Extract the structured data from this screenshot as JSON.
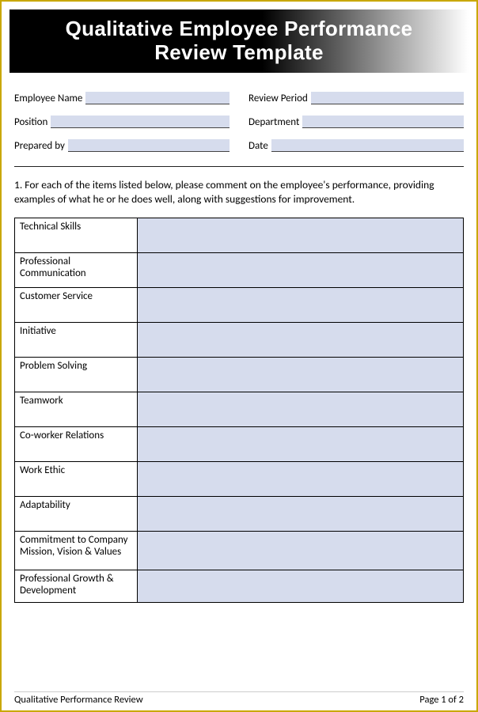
{
  "header": {
    "title_line1": "Qualitative Employee Performance",
    "title_line2": "Review Template"
  },
  "fields": {
    "left": [
      {
        "label": "Employee Name"
      },
      {
        "label": "Position"
      },
      {
        "label": "Prepared by"
      }
    ],
    "right": [
      {
        "label": "Review Period"
      },
      {
        "label": "Department"
      },
      {
        "label": "Date"
      }
    ]
  },
  "instructions": "1. For each of the items listed below, please comment on the employee's performance, providing examples of what he or he does well, along with suggestions for improvement.",
  "categories": [
    "Technical Skills",
    "Professional Communication",
    "Customer Service",
    "Initiative",
    "Problem Solving",
    "Teamwork",
    "Co-worker Relations",
    "Work Ethic",
    "Adaptability",
    "Commitment to Company Mission, Vision & Values",
    "Professional Growth & Development"
  ],
  "footer": {
    "left": "Qualitative Performance Review",
    "right": "Page 1 of 2"
  }
}
